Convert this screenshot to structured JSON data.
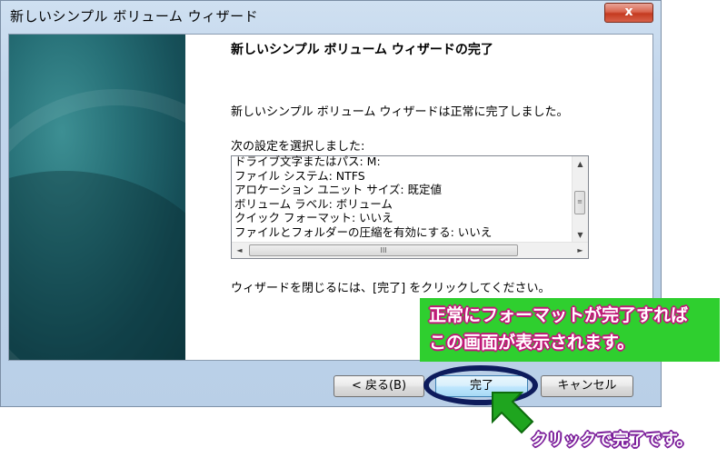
{
  "window": {
    "title": "新しいシンプル ボリューム ウィザード",
    "close_label": "x"
  },
  "page": {
    "heading": "新しいシンプル ボリューム ウィザードの完了",
    "completion_message": "新しいシンプル ボリューム ウィザードは正常に完了しました。",
    "settings_label": "次の設定を選択しました:",
    "settings": [
      "ドライブ文字またはパス: M:",
      "ファイル システム: NTFS",
      "アロケーション ユニット サイズ: 既定値",
      "ボリューム ラベル: ボリューム",
      "クイック フォーマット: いいえ",
      "ファイルとフォルダーの圧縮を有効にする: いいえ"
    ],
    "close_instruction": "ウィザードを閉じるには、[完了] をクリックしてください。"
  },
  "buttons": {
    "back": "< 戻る(B)",
    "finish": "完了",
    "cancel": "キャンセル"
  },
  "annotation": {
    "callout_line1": "正常にフォーマットが完了すれば",
    "callout_line2": "この画面が表示されます。",
    "click_label": "クリックで完了です。"
  },
  "colors": {
    "banner": "#1f5f66",
    "callout_bg": "#2fcf2f",
    "callout_outline": "#c01878",
    "highlight_ring": "#0d1b5c",
    "arrow": "#1fa51f",
    "click_outline": "#7b1d9a"
  },
  "icons": {
    "scroll_up": "▲",
    "scroll_down": "▼",
    "scroll_left": "◄",
    "scroll_right": "►",
    "grip": "≡",
    "hgrip": "III"
  }
}
